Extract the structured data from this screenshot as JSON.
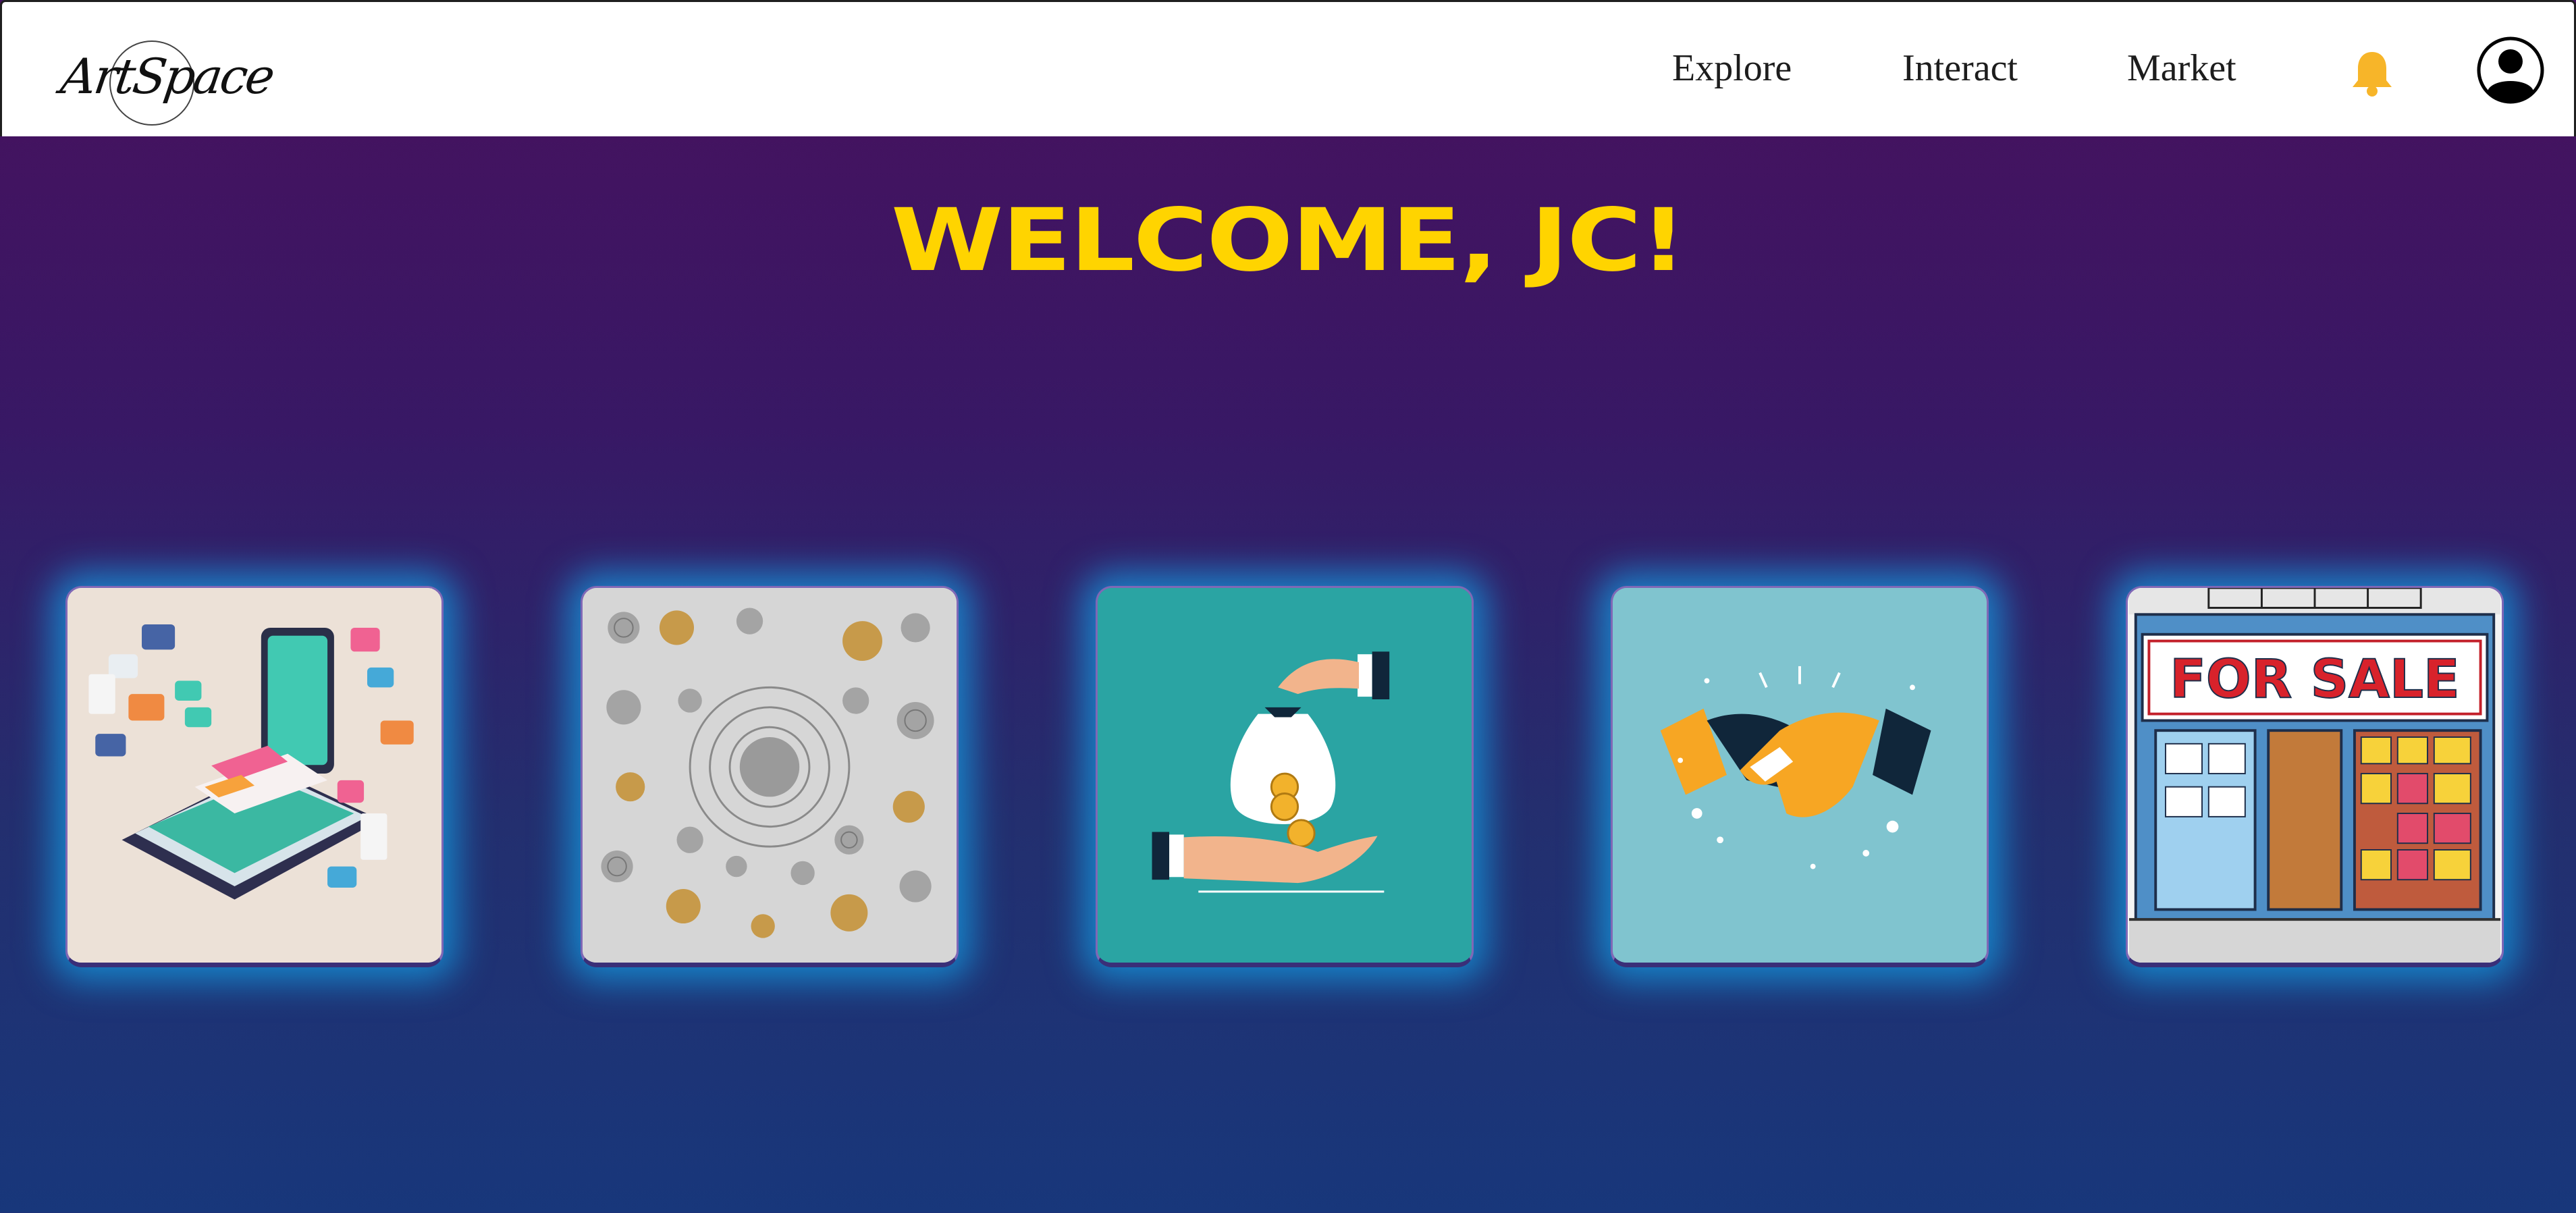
{
  "brand": {
    "logo_text": "ArtSpace"
  },
  "nav": {
    "explore": "Explore",
    "interact": "Interact",
    "market": "Market"
  },
  "icons": {
    "bell": "bell-icon",
    "profile": "user-circle-icon"
  },
  "colors": {
    "accent": "#ffd400",
    "bell": "#f7b529",
    "glow": "#14a5eb",
    "background_top": "#48115e",
    "background_bottom": "#18377b"
  },
  "welcome": {
    "title": "WELCOME, JC!"
  },
  "cards": [
    {
      "illustration": "phone-messages-illustration"
    },
    {
      "illustration": "ornamental-pattern-illustration"
    },
    {
      "illustration": "money-bag-hands-illustration"
    },
    {
      "illustration": "handshake-illustration"
    },
    {
      "illustration": "for-sale-storefront-illustration",
      "sign_text": "FOR SALE"
    }
  ]
}
